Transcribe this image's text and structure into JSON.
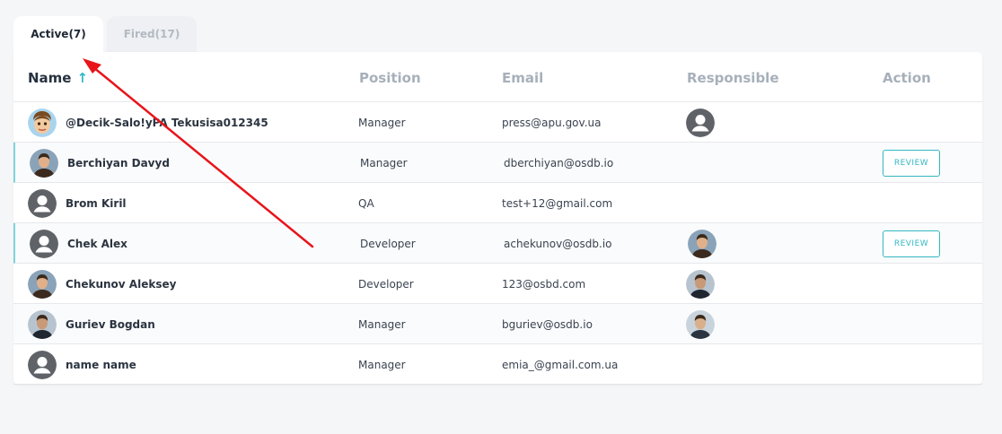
{
  "tabs": [
    {
      "label": "Active(7)",
      "active": true
    },
    {
      "label": "Fired(17)",
      "active": false
    }
  ],
  "table": {
    "headers": {
      "name": "Name",
      "position": "Position",
      "email": "Email",
      "responsible": "Responsible",
      "action": "Action"
    },
    "sort_icon": "arrow-up-icon",
    "rows": [
      {
        "name": "@Decik-Salo!yPA Tekusisa012345",
        "position": "Manager",
        "email": "press@apu.gov.ua",
        "avatar": "cartoon-avatar",
        "responsible_avatar": "placeholder-user-icon",
        "action": ""
      },
      {
        "name": "Berchiyan Davyd",
        "position": "Manager",
        "email": "dberchiyan@osdb.io",
        "avatar": "photo-avatar",
        "responsible_avatar": "",
        "action": "REVIEW"
      },
      {
        "name": "Brom Kiril",
        "position": "QA",
        "email": "test+12@gmail.com",
        "avatar": "placeholder-user-icon",
        "responsible_avatar": "",
        "action": ""
      },
      {
        "name": "Chek Alex",
        "position": "Developer",
        "email": "achekunov@osdb.io",
        "avatar": "placeholder-user-icon",
        "responsible_avatar": "photo-avatar",
        "action": "REVIEW"
      },
      {
        "name": "Chekunov Aleksey",
        "position": "Developer",
        "email": "123@osbd.com",
        "avatar": "photo-avatar",
        "responsible_avatar": "photo-avatar",
        "action": ""
      },
      {
        "name": "Guriev Bogdan",
        "position": "Manager",
        "email": "bguriev@osdb.io",
        "avatar": "photo-avatar",
        "responsible_avatar": "photo-avatar",
        "action": ""
      },
      {
        "name": "name name",
        "position": "Manager",
        "email": "emia_@gmail.com.ua",
        "avatar": "placeholder-user-icon",
        "responsible_avatar": "",
        "action": ""
      }
    ]
  },
  "colors": {
    "accent": "#34b7c2",
    "annotation_arrow": "#e8141a"
  }
}
